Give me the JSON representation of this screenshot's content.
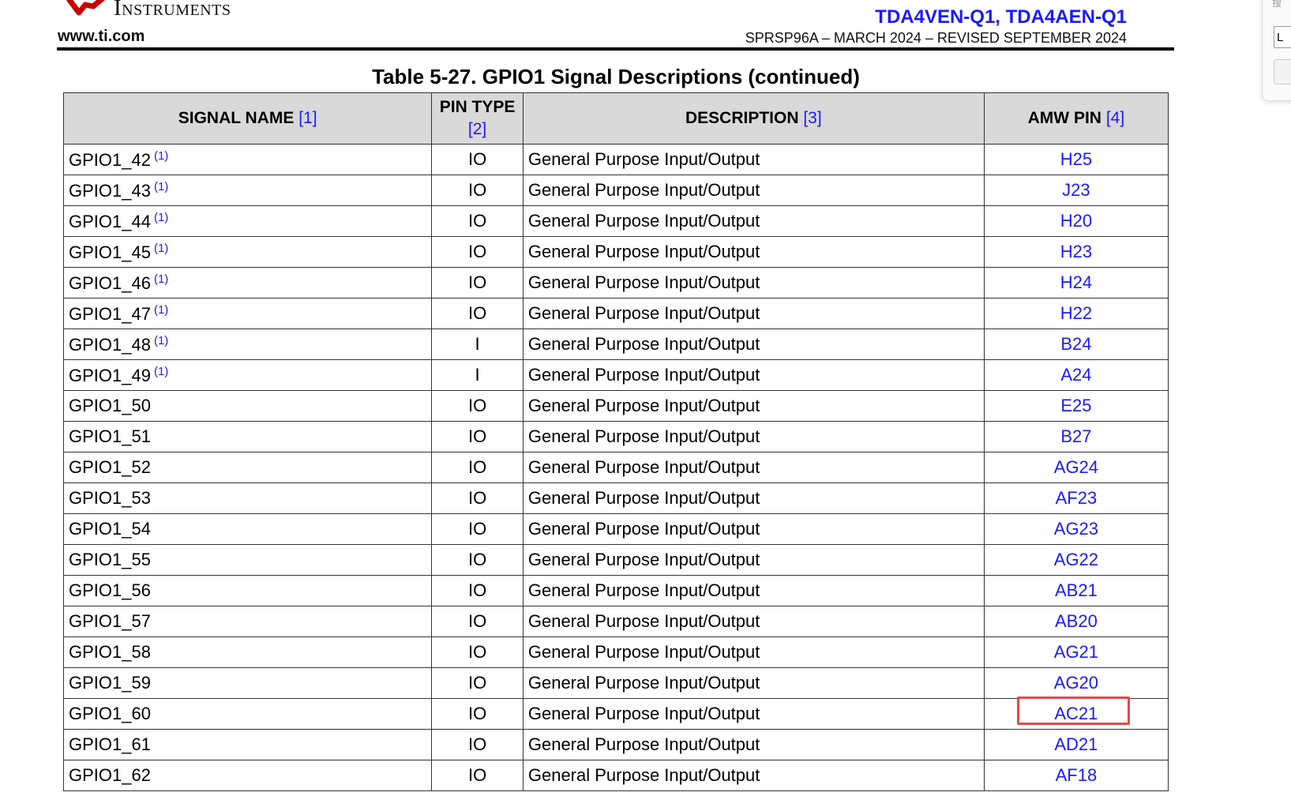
{
  "header": {
    "brand": "Instruments",
    "site": "www.ti.com",
    "doc_title": "TDA4VEN-Q1, TDA4AEN-Q1",
    "doc_revision": "SPRSP96A – MARCH 2024 – REVISED SEPTEMBER 2024"
  },
  "table": {
    "title": "Table 5-27. GPIO1 Signal Descriptions (continued)",
    "headers": {
      "signal_name": "SIGNAL NAME",
      "signal_ref": "[1]",
      "pin_type_1": "PIN TYPE",
      "pin_type_ref": "[2]",
      "description": "DESCRIPTION",
      "description_ref": "[3]",
      "amw_pin": "AMW PIN",
      "amw_ref": "[4]"
    },
    "rows": [
      {
        "name": "GPIO1_42",
        "fn": "(1)",
        "type": "IO",
        "desc": "General Purpose Input/Output",
        "pin": "H25"
      },
      {
        "name": "GPIO1_43",
        "fn": "(1)",
        "type": "IO",
        "desc": "General Purpose Input/Output",
        "pin": "J23"
      },
      {
        "name": "GPIO1_44",
        "fn": "(1)",
        "type": "IO",
        "desc": "General Purpose Input/Output",
        "pin": "H20"
      },
      {
        "name": "GPIO1_45",
        "fn": "(1)",
        "type": "IO",
        "desc": "General Purpose Input/Output",
        "pin": "H23"
      },
      {
        "name": "GPIO1_46",
        "fn": "(1)",
        "type": "IO",
        "desc": "General Purpose Input/Output",
        "pin": "H24"
      },
      {
        "name": "GPIO1_47",
        "fn": "(1)",
        "type": "IO",
        "desc": "General Purpose Input/Output",
        "pin": "H22"
      },
      {
        "name": "GPIO1_48",
        "fn": "(1)",
        "type": "I",
        "desc": "General Purpose Input/Output",
        "pin": "B24"
      },
      {
        "name": "GPIO1_49",
        "fn": "(1)",
        "type": "I",
        "desc": "General Purpose Input/Output",
        "pin": "A24"
      },
      {
        "name": "GPIO1_50",
        "fn": "",
        "type": "IO",
        "desc": "General Purpose Input/Output",
        "pin": "E25"
      },
      {
        "name": "GPIO1_51",
        "fn": "",
        "type": "IO",
        "desc": "General Purpose Input/Output",
        "pin": "B27"
      },
      {
        "name": "GPIO1_52",
        "fn": "",
        "type": "IO",
        "desc": "General Purpose Input/Output",
        "pin": "AG24"
      },
      {
        "name": "GPIO1_53",
        "fn": "",
        "type": "IO",
        "desc": "General Purpose Input/Output",
        "pin": "AF23"
      },
      {
        "name": "GPIO1_54",
        "fn": "",
        "type": "IO",
        "desc": "General Purpose Input/Output",
        "pin": "AG23"
      },
      {
        "name": "GPIO1_55",
        "fn": "",
        "type": "IO",
        "desc": "General Purpose Input/Output",
        "pin": "AG22"
      },
      {
        "name": "GPIO1_56",
        "fn": "",
        "type": "IO",
        "desc": "General Purpose Input/Output",
        "pin": "AB21"
      },
      {
        "name": "GPIO1_57",
        "fn": "",
        "type": "IO",
        "desc": "General Purpose Input/Output",
        "pin": "AB20"
      },
      {
        "name": "GPIO1_58",
        "fn": "",
        "type": "IO",
        "desc": "General Purpose Input/Output",
        "pin": "AG21"
      },
      {
        "name": "GPIO1_59",
        "fn": "",
        "type": "IO",
        "desc": "General Purpose Input/Output",
        "pin": "AG20"
      },
      {
        "name": "GPIO1_60",
        "fn": "",
        "type": "IO",
        "desc": "General Purpose Input/Output",
        "pin": "AC21"
      },
      {
        "name": "GPIO1_61",
        "fn": "",
        "type": "IO",
        "desc": "General Purpose Input/Output",
        "pin": "AD21"
      },
      {
        "name": "GPIO1_62",
        "fn": "",
        "type": "IO",
        "desc": "General Purpose Input/Output",
        "pin": "AF18"
      }
    ]
  },
  "highlight": {
    "row": 18,
    "color": "#e8474b"
  },
  "side_panel": {
    "label": "搜",
    "input_value": "L"
  },
  "colors": {
    "link": "#1a1aff",
    "header_bg": "#d9d9d9",
    "ti_red": "#cc0000"
  }
}
